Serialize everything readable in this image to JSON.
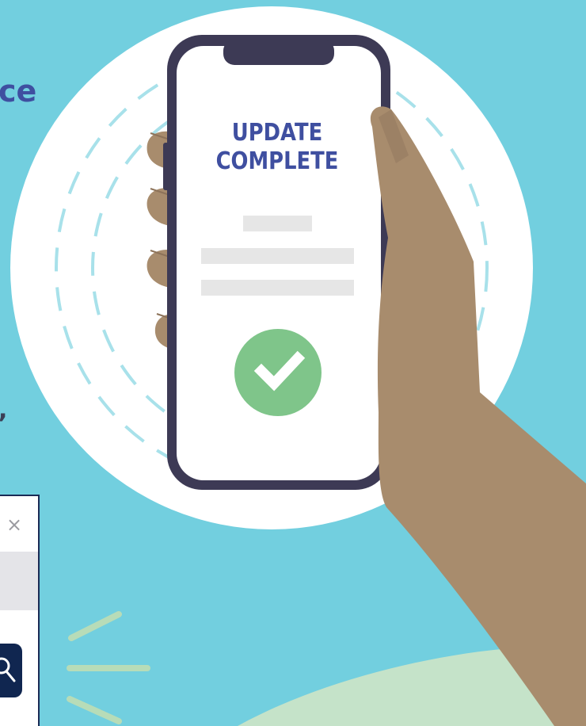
{
  "colors": {
    "background": "#72cfdf",
    "circle": "#ffffff",
    "phone_frame": "#3d3a55",
    "heading_blue": "#3f4fa0",
    "skin": "#a88c6d",
    "success_green": "#7fc58a",
    "hill_green": "#c5e3c9",
    "dialog_navy": "#102650"
  },
  "phone": {
    "title_line1": "UPDATE",
    "title_line2": "COMPLETE",
    "status_icon": "checkmark-icon"
  },
  "left_text": {
    "heading_fragment": "ce",
    "comma_fragment": ","
  },
  "dialog": {
    "close_icon": "close-icon",
    "close_glyph": "×",
    "search_icon": "search-icon"
  }
}
